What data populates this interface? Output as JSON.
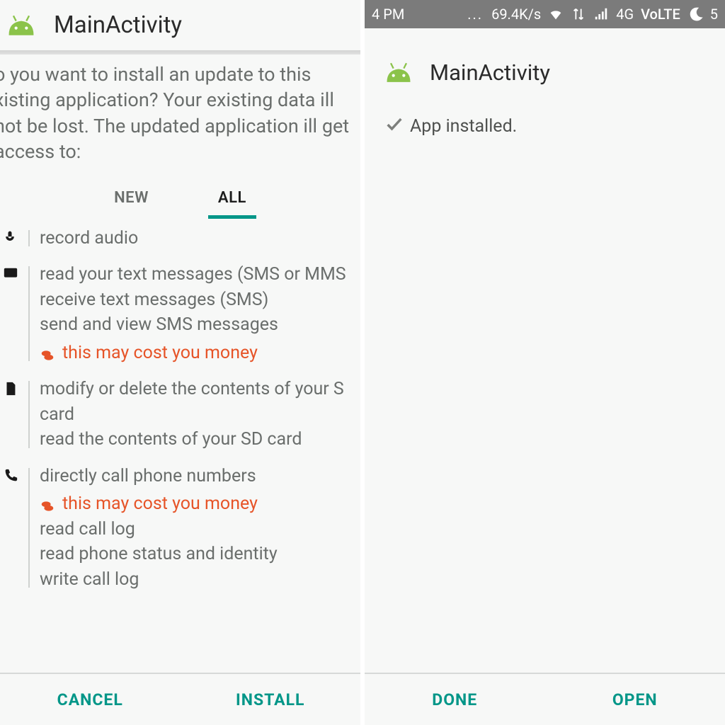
{
  "left": {
    "title": "MainActivity",
    "prompt": "o you want to install an update to this xisting application? Your existing data ill not be lost. The updated application ill get access to:",
    "tabs": {
      "new": "NEW",
      "all": "ALL"
    },
    "sections": [
      {
        "icon": "mic",
        "lines": [
          "record audio"
        ]
      },
      {
        "icon": "sms",
        "lines": [
          "read your text messages (SMS or MMS",
          "receive text messages (SMS)",
          "send and view SMS messages"
        ],
        "cost": "this may cost you money"
      },
      {
        "icon": "sd",
        "lines": [
          "modify or delete the contents of your S card",
          "read the contents of your SD card"
        ]
      },
      {
        "icon": "phone",
        "lines": [
          "directly call phone numbers"
        ],
        "cost": "this may cost you money",
        "more": [
          "read call log",
          "read phone status and identity",
          "write call log"
        ]
      }
    ],
    "buttons": {
      "cancel": "CANCEL",
      "install": "INSTALL"
    }
  },
  "right": {
    "status": {
      "time": "4 PM",
      "speed": "69.4K/s",
      "net": "4G",
      "volte": "VoLTE",
      "extra": "5"
    },
    "title": "MainActivity",
    "installed": "App installed.",
    "buttons": {
      "done": "DONE",
      "open": "OPEN"
    }
  }
}
